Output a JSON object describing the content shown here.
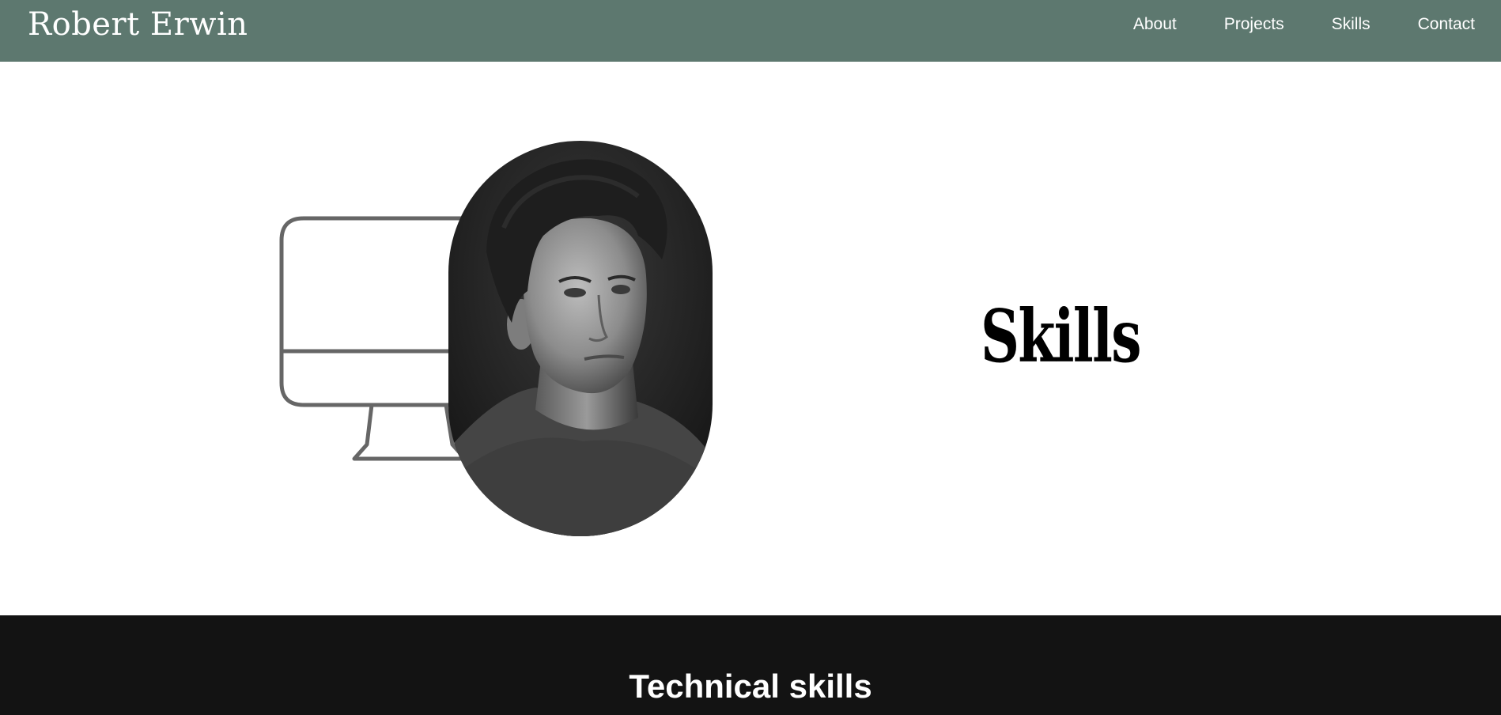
{
  "header": {
    "brand": "Robert Erwin",
    "nav": [
      {
        "label": "About"
      },
      {
        "label": "Projects"
      },
      {
        "label": "Skills"
      },
      {
        "label": "Contact"
      }
    ],
    "background_color": "#5d786f"
  },
  "hero": {
    "title": "Skills",
    "illustration_icon": "desktop-monitor-icon",
    "portrait": "black-and-white-portrait-photo"
  },
  "technical": {
    "heading": "Technical skills",
    "background_color": "#131313"
  }
}
